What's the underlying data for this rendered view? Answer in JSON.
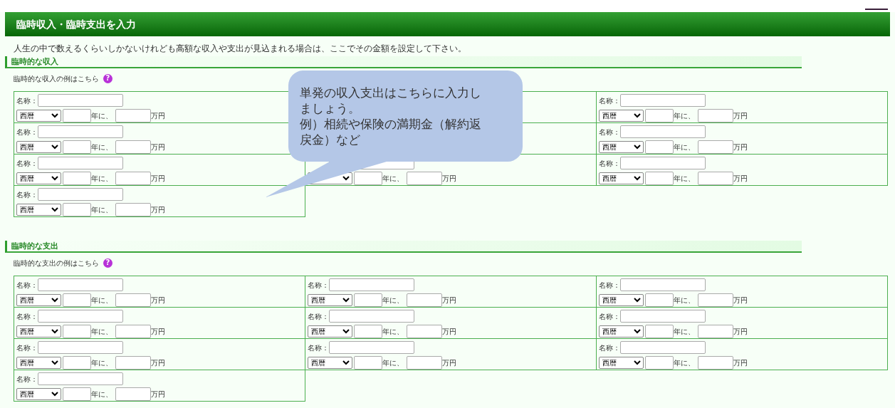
{
  "header": {
    "title": "臨時収入・臨時支出を入力"
  },
  "intro": "人生の中で数えるくらいしかないけれども高額な収入や支出が見込まれる場合は、ここでその金額を設定して下さい。",
  "sections": [
    {
      "heading": "臨時的な収入",
      "help_text": "臨時的な収入の例はこちら",
      "help_mark": "?",
      "cells": [
        {
          "label": "名称：",
          "era": "西暦",
          "year_suffix": "年に、",
          "unit": "万円"
        },
        {},
        {
          "label": "名称：",
          "era": "西暦",
          "year_suffix": "年に、",
          "unit": "万円"
        },
        {
          "label": "名称：",
          "era": "西暦",
          "year_suffix": "年に、",
          "unit": "万円"
        },
        {},
        {
          "label": "名称：",
          "era": "西暦",
          "year_suffix": "年に、",
          "unit": "万円"
        },
        {
          "label": "名称：",
          "era": "西暦",
          "year_suffix": "年に、",
          "unit": "万円"
        },
        {
          "year_suffix": "年に、",
          "unit": "万円"
        },
        {
          "label": "名称：",
          "era": "西暦",
          "year_suffix": "年に、",
          "unit": "万円"
        },
        {
          "label": "名称：",
          "era": "西暦",
          "year_suffix": "年に、",
          "unit": "万円"
        }
      ]
    },
    {
      "heading": "臨時的な支出",
      "help_text": "臨時的な支出の例はこちら",
      "help_mark": "?",
      "cells": [
        {
          "label": "名称：",
          "era": "西暦",
          "year_suffix": "年に、",
          "unit": "万円"
        },
        {
          "label": "名称：",
          "era": "西暦",
          "year_suffix": "年に、",
          "unit": "万円"
        },
        {
          "label": "名称：",
          "era": "西暦",
          "year_suffix": "年に、",
          "unit": "万円"
        },
        {
          "label": "名称：",
          "era": "西暦",
          "year_suffix": "年に、",
          "unit": "万円"
        },
        {
          "label": "名称：",
          "era": "西暦",
          "year_suffix": "年に、",
          "unit": "万円"
        },
        {
          "label": "名称：",
          "era": "西暦",
          "year_suffix": "年に、",
          "unit": "万円"
        },
        {
          "label": "名称：",
          "era": "西暦",
          "year_suffix": "年に、",
          "unit": "万円"
        },
        {
          "label": "名称：",
          "era": "西暦",
          "year_suffix": "年に、",
          "unit": "万円"
        },
        {
          "label": "名称：",
          "era": "西暦",
          "year_suffix": "年に、",
          "unit": "万円"
        },
        {
          "label": "名称：",
          "era": "西暦",
          "year_suffix": "年に、",
          "unit": "万円"
        }
      ]
    }
  ],
  "callout": {
    "lines": [
      "単発の収入支出はこちらに入力しましょう。",
      "例）相続や保険の満期金（解約返戻金）など"
    ]
  }
}
